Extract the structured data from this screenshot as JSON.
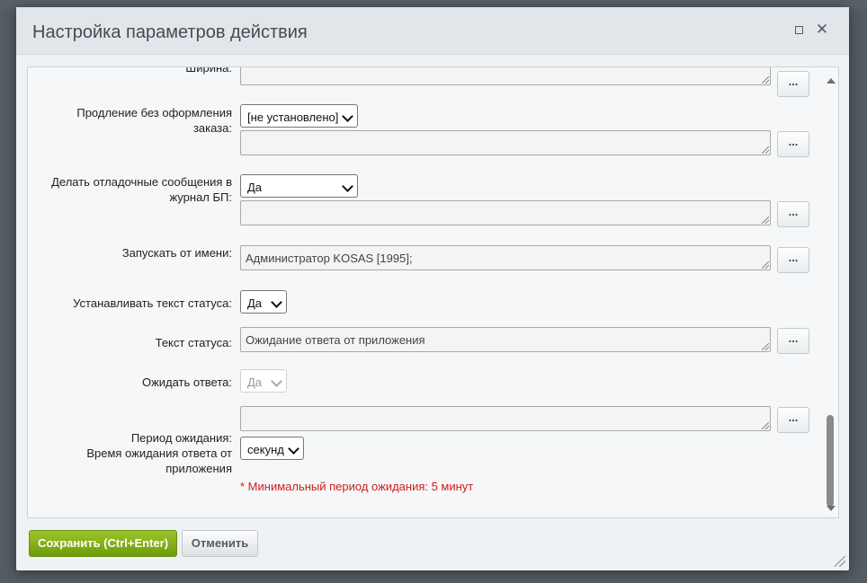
{
  "dialog": {
    "title": "Настройка параметров действия",
    "maximize_icon": "maximize-icon",
    "close_icon": "close-icon"
  },
  "fields": {
    "width_label": "Ширина:",
    "extension_label_line1": "Продление без оформления",
    "extension_label_line2": "заказа:",
    "extension_select": "[не установлено]",
    "debug_label_line1": "Делать отладочные сообщения в",
    "debug_label_line2": "журнал БП:",
    "debug_select": "Да",
    "run_as_label": "Запускать от имени:",
    "run_as_value": "Администратор KOSAS [1995];",
    "set_status_label": "Устанавливать текст статуса:",
    "set_status_select": "Да",
    "status_text_label": "Текст статуса:",
    "status_text_value": "Ожидание ответа от приложения",
    "wait_label": "Ожидать ответа:",
    "wait_select": "Да",
    "period_label_line1": "Период ожидания:",
    "period_label_line2": "Время ожидания ответа от",
    "period_label_line3": "приложения",
    "period_unit_select": "секунд",
    "period_note": "* Минимальный период ожидания: 5 минут",
    "dots_label": "..."
  },
  "footer": {
    "save_label": "Сохранить (Ctrl+Enter)",
    "cancel_label": "Отменить"
  },
  "colors": {
    "save_button": "#7fad14",
    "note": "#d21d1d",
    "titlebar": "#e1e6ea"
  }
}
